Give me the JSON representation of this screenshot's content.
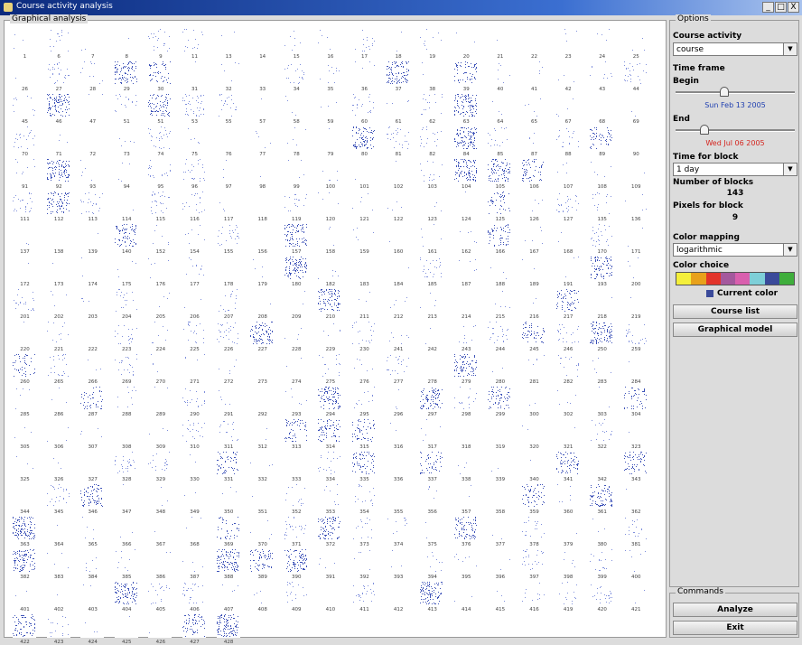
{
  "window": {
    "title": "Course activity analysis",
    "buttons": [
      "_",
      "□",
      "X"
    ]
  },
  "graphical_analysis": {
    "label": "Graphical analysis",
    "thumbnails": [
      "1",
      "6",
      "7",
      "8",
      "9",
      "11",
      "13",
      "14",
      "15",
      "16",
      "17",
      "18",
      "19",
      "20",
      "21",
      "22",
      "23",
      "24",
      "25",
      "26",
      "27",
      "28",
      "29",
      "30",
      "31",
      "32",
      "33",
      "34",
      "35",
      "36",
      "37",
      "38",
      "39",
      "40",
      "41",
      "42",
      "43",
      "44",
      "45",
      "46",
      "47",
      "51",
      "51",
      "53",
      "55",
      "57",
      "58",
      "59",
      "60",
      "61",
      "62",
      "63",
      "64",
      "65",
      "67",
      "68",
      "69",
      "70",
      "71",
      "72",
      "73",
      "74",
      "75",
      "76",
      "77",
      "78",
      "79",
      "80",
      "81",
      "82",
      "84",
      "85",
      "87",
      "88",
      "89",
      "90",
      "91",
      "92",
      "93",
      "94",
      "95",
      "96",
      "97",
      "98",
      "99",
      "100",
      "101",
      "102",
      "103",
      "104",
      "105",
      "106",
      "107",
      "108",
      "109",
      "111",
      "112",
      "113",
      "114",
      "115",
      "116",
      "117",
      "118",
      "119",
      "120",
      "121",
      "122",
      "123",
      "124",
      "125",
      "126",
      "127",
      "135",
      "136",
      "137",
      "138",
      "139",
      "140",
      "152",
      "154",
      "155",
      "156",
      "157",
      "158",
      "159",
      "160",
      "161",
      "162",
      "166",
      "167",
      "168",
      "170",
      "171",
      "172",
      "173",
      "174",
      "175",
      "176",
      "177",
      "178",
      "179",
      "180",
      "182",
      "183",
      "184",
      "185",
      "187",
      "188",
      "189",
      "191",
      "193",
      "200",
      "201",
      "202",
      "203",
      "204",
      "205",
      "206",
      "207",
      "208",
      "209",
      "210",
      "211",
      "212",
      "213",
      "214",
      "215",
      "216",
      "217",
      "218",
      "219",
      "220",
      "221",
      "222",
      "223",
      "224",
      "225",
      "226",
      "227",
      "228",
      "229",
      "230",
      "241",
      "242",
      "243",
      "244",
      "245",
      "246",
      "250",
      "259",
      "260",
      "265",
      "266",
      "269",
      "270",
      "271",
      "272",
      "273",
      "274",
      "275",
      "276",
      "277",
      "278",
      "279",
      "280",
      "281",
      "282",
      "283",
      "284",
      "285",
      "286",
      "287",
      "288",
      "289",
      "290",
      "291",
      "292",
      "293",
      "294",
      "295",
      "296",
      "297",
      "298",
      "299",
      "300",
      "302",
      "303",
      "304",
      "305",
      "306",
      "307",
      "308",
      "309",
      "310",
      "311",
      "312",
      "313",
      "314",
      "315",
      "316",
      "317",
      "318",
      "319",
      "320",
      "321",
      "322",
      "323",
      "325",
      "326",
      "327",
      "328",
      "329",
      "330",
      "331",
      "332",
      "333",
      "334",
      "335",
      "336",
      "337",
      "338",
      "339",
      "340",
      "341",
      "342",
      "343",
      "344",
      "345",
      "346",
      "347",
      "348",
      "349",
      "350",
      "351",
      "352",
      "353",
      "354",
      "355",
      "356",
      "357",
      "358",
      "359",
      "360",
      "361",
      "362",
      "363",
      "364",
      "365",
      "366",
      "367",
      "368",
      "369",
      "370",
      "371",
      "372",
      "373",
      "374",
      "375",
      "376",
      "377",
      "378",
      "379",
      "380",
      "381",
      "382",
      "383",
      "384",
      "385",
      "386",
      "387",
      "388",
      "389",
      "390",
      "391",
      "392",
      "393",
      "394",
      "395",
      "396",
      "397",
      "398",
      "399",
      "400",
      "401",
      "402",
      "403",
      "404",
      "405",
      "406",
      "407",
      "408",
      "409",
      "410",
      "411",
      "412",
      "413",
      "414",
      "415",
      "416",
      "419",
      "420",
      "421",
      "422",
      "423",
      "424",
      "425",
      "426",
      "427",
      "428"
    ]
  },
  "options": {
    "label": "Options",
    "course_activity": {
      "label": "Course activity",
      "value": "course"
    },
    "time_frame": {
      "label": "Time frame",
      "begin_label": "Begin",
      "begin_value": 0.4,
      "begin_date": "Sun Feb 13 2005",
      "end_label": "End",
      "end_value": 0.22,
      "end_date": "Wed Jul 06 2005"
    },
    "time_for_block": {
      "label": "Time for block",
      "value": "1 day"
    },
    "number_of_blocks": {
      "label": "Number of blocks",
      "value": "143"
    },
    "pixels_for_block": {
      "label": "Pixels for block",
      "value": "9"
    },
    "color_mapping": {
      "label": "Color mapping",
      "value": "logarithmic"
    },
    "color_choice": {
      "label": "Color choice",
      "colors": [
        "#f4ef3a",
        "#e8a11b",
        "#e2342a",
        "#a4589d",
        "#d95fae",
        "#7ecfd8",
        "#3a4a9a",
        "#3fae3c"
      ],
      "current_label": "Current color"
    },
    "buttons": {
      "course_list": "Course list",
      "graphical_model": "Graphical model"
    }
  },
  "commands": {
    "label": "Commands",
    "analyze": "Analyze",
    "exit": "Exit"
  }
}
